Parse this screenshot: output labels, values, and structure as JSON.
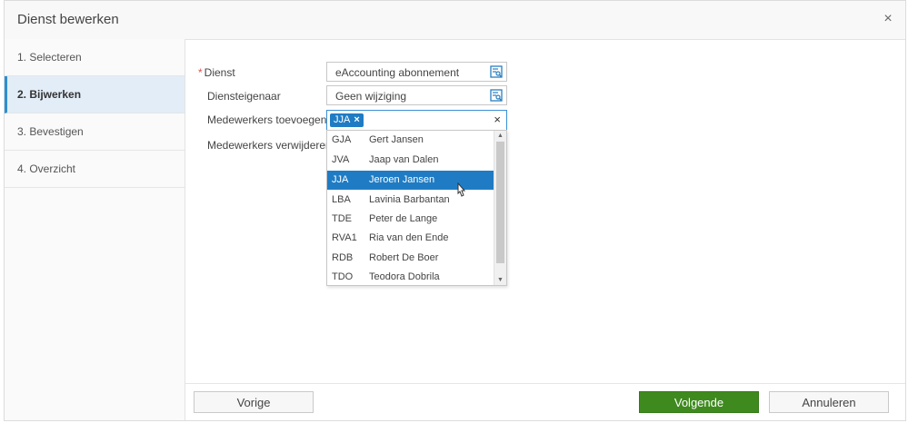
{
  "dialog": {
    "title": "Dienst bewerken",
    "close_label": "×"
  },
  "steps": [
    {
      "label": "1. Selecteren"
    },
    {
      "label": "2. Bijwerken"
    },
    {
      "label": "3. Bevestigen"
    },
    {
      "label": "4. Overzicht"
    }
  ],
  "form": {
    "required_mark": "*",
    "dienst_label": "Dienst",
    "dienst_value": "eAccounting abonnement",
    "eigenaar_label": "Diensteigenaar",
    "eigenaar_value": "Geen wijziging",
    "toevoegen_label": "Medewerkers toevoegen",
    "verwijderen_label": "Medewerkers verwijderen",
    "tag_label": "JJA",
    "tag_remove": "×",
    "clear_label": "×"
  },
  "dropdown": {
    "options": [
      {
        "code": "GJA",
        "name": "Gert Jansen"
      },
      {
        "code": "JVA",
        "name": "Jaap van Dalen"
      },
      {
        "code": "JJA",
        "name": "Jeroen Jansen"
      },
      {
        "code": "LBA",
        "name": "Lavinia Barbantan"
      },
      {
        "code": "TDE",
        "name": "Peter de Lange"
      },
      {
        "code": "RVA1",
        "name": "Ria van den Ende"
      },
      {
        "code": "RDB",
        "name": "Robert De Boer"
      },
      {
        "code": "TDO",
        "name": "Teodora Dobrila"
      }
    ],
    "selected_index": 2
  },
  "footer": {
    "prev_label": "Vorige",
    "next_label": "Volgende",
    "cancel_label": "Annuleren"
  },
  "colors": {
    "accent": "#1f7cc4",
    "primary_button": "#3f8a1f",
    "active_step_bg": "#e2edf7"
  }
}
